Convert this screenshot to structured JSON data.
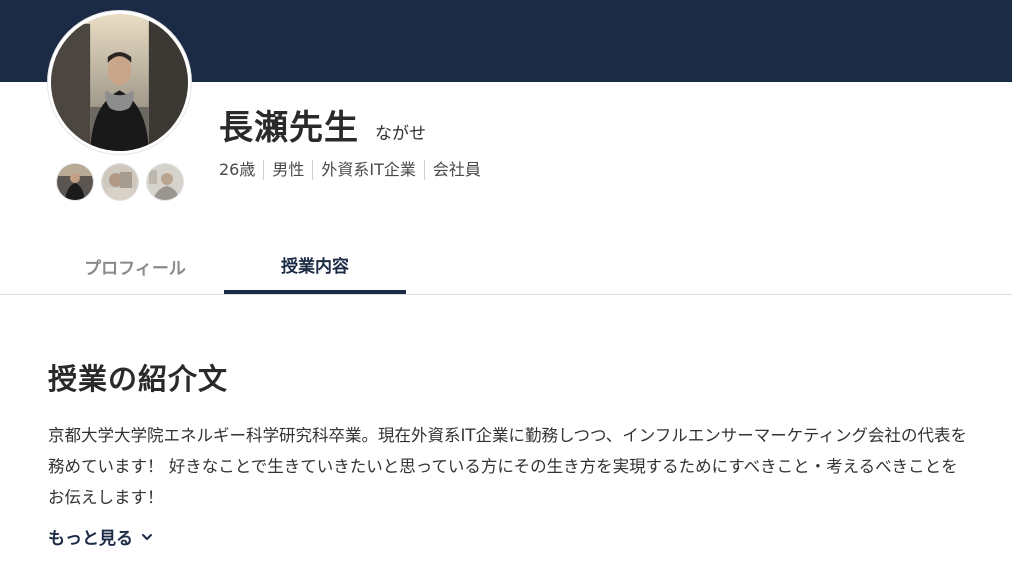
{
  "profile": {
    "name": "長瀬先生",
    "kana": "ながせ",
    "attributes": [
      "26歳",
      "男性",
      "外資系IT企業",
      "会社員"
    ]
  },
  "tabs": [
    {
      "label": "プロフィール",
      "active": false
    },
    {
      "label": "授業内容",
      "active": true
    }
  ],
  "section": {
    "title": "授業の紹介文",
    "text": "京都大学大学院エネルギー科学研究科卒業。現在外資系IT企業に勤務しつつ、インフルエンサーマーケティング会社の代表を務めています！ 好きなことで生きていきたいと思っている方にその生き方を実現するためにすべきこと・考えるべきことをお伝えします！",
    "more_label": "もっと見る"
  },
  "colors": {
    "brand": "#1c2b45",
    "tab_inactive": "#8a8a8a"
  },
  "icons": {
    "more": "chevron-down-icon"
  }
}
